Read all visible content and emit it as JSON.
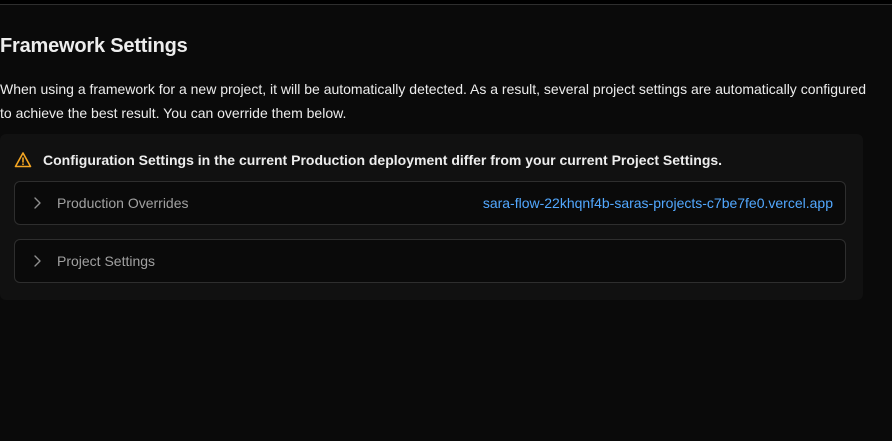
{
  "section": {
    "title": "Framework Settings",
    "description": "When using a framework for a new project, it will be automatically detected. As a result, several project settings are automatically configured to achieve the best result. You can override them below."
  },
  "warning": {
    "icon": "warning-triangle-icon",
    "text": "Configuration Settings in the current Production deployment differ from your current Project Settings.",
    "color": "#f5a623"
  },
  "accordions": [
    {
      "label": "Production Overrides",
      "link": "sara-flow-22khqnf4b-saras-projects-c7be7fe0.vercel.app",
      "icon": "chevron-right-icon"
    },
    {
      "label": "Project Settings",
      "icon": "chevron-right-icon"
    }
  ],
  "colors": {
    "background": "#0a0a0a",
    "link": "#52a8ff",
    "muted_text": "#a1a1a1"
  }
}
